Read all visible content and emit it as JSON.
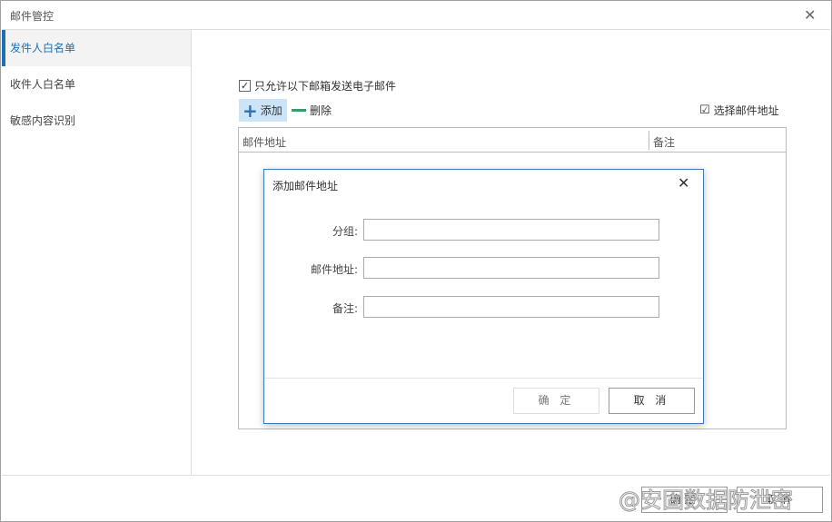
{
  "window": {
    "title": "邮件管控",
    "close_icon": "close-icon"
  },
  "sidebar": {
    "items": [
      {
        "label": "发件人白名单",
        "active": true
      },
      {
        "label": "收件人白名单"
      },
      {
        "label": "敏感内容识别"
      }
    ]
  },
  "main": {
    "checkbox_label": "只允许以下邮箱发送电子邮件",
    "checkbox_checked": true,
    "add_label": "添加",
    "delete_label": "删除",
    "select_label": "选择邮件地址",
    "table": {
      "columns": [
        "邮件地址",
        "备注"
      ],
      "rows": []
    }
  },
  "dialog": {
    "title": "添加邮件地址",
    "fields": [
      {
        "label": "分组:",
        "value": ""
      },
      {
        "label": "邮件地址:",
        "value": ""
      },
      {
        "label": "备注:",
        "value": ""
      }
    ],
    "ok": "确 定",
    "cancel": "取 消"
  },
  "footer": {
    "ok": "确定",
    "cancel": "取消"
  },
  "watermark": "@安固数据防泄密",
  "colors": {
    "accent": "#1e6fb5",
    "add_bg": "#cce4f7",
    "delete": "#3a9a6a"
  }
}
